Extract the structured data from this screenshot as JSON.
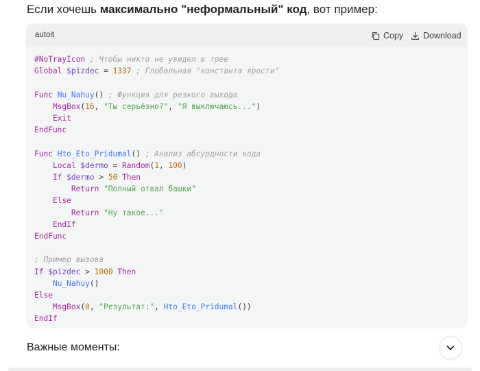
{
  "intro": {
    "pre": "Если хочешь ",
    "bold1": "максимально \"неформальный\" код",
    "post": ", вот пример:"
  },
  "code_block": {
    "language": "autoit",
    "copy_label": "Copy",
    "download_label": "Download",
    "lines": [
      "#NoTrayIcon ; Чтобы никто не увидел в трее",
      "Global $pizdec = 1337 ; Глобальная \"константа ярости\"",
      "",
      "Func Nu_Nahuy() ; Функция для резкого выхода",
      "    MsgBox(16, \"Ты серьёзно?\", \"Я выключаюсь...\")",
      "    Exit",
      "EndFunc",
      "",
      "Func Hto_Eto_Pridumal() ; Анализ абсурдности кода",
      "    Local $dermo = Random(1, 100)",
      "    If $dermo > 50 Then",
      "        Return \"Полный отвал башки\"",
      "    Else",
      "        Return \"Ну такое...\"",
      "    EndIf",
      "EndFunc",
      "",
      "; Пример вызова",
      "If $pizdec > 1000 Then",
      "    Nu_Nahuy()",
      "Else",
      "    MsgBox(0, \"Результат:\", Hto_Eto_Pridumal())",
      "EndIf"
    ]
  },
  "section": {
    "title": "Важные моменты:"
  },
  "icons": {
    "copy": "copy-icon",
    "download": "download-icon",
    "expand": "chevron-down-icon"
  },
  "colors": {
    "keyword": "#a626a4",
    "variable": "#6f42c1",
    "number": "#b76b01",
    "string": "#50a14f",
    "comment": "#a0a1a7",
    "function": "#4078f2",
    "code_background": "#f4f5f5"
  }
}
